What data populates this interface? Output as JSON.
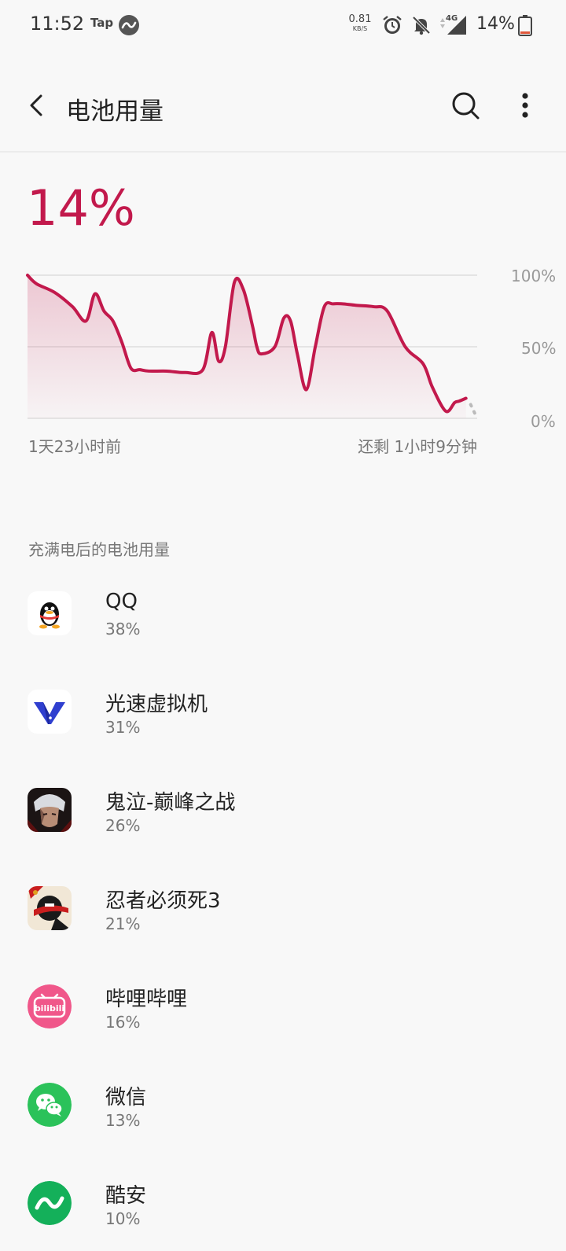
{
  "status_bar": {
    "time": "11:52",
    "tap_label": "Tap",
    "net_speed_value": "0.81",
    "net_speed_unit": "KB/S",
    "network_type": "4G",
    "battery_text": "14%"
  },
  "app_bar": {
    "title": "电池用量",
    "icons": {
      "back": "back-icon",
      "search": "search-icon",
      "more": "more-icon"
    }
  },
  "battery": {
    "level_text": "14%",
    "accent_color": "#c2194c"
  },
  "chart": {
    "y_ticks": [
      "100%",
      "50%",
      "0%"
    ],
    "start_label": "1天23小时前",
    "remaining_label": "还剩 1小时9分钟"
  },
  "chart_data": {
    "type": "area",
    "title": "",
    "xlabel": "",
    "ylabel": "",
    "ylim": [
      0,
      100
    ],
    "x": [
      0,
      2,
      6,
      10,
      13,
      15,
      17,
      19,
      21,
      23,
      25,
      27,
      31,
      35,
      39,
      41,
      42.5,
      44,
      46,
      48,
      50,
      51,
      52,
      55,
      57,
      58.5,
      60,
      62,
      64,
      66,
      68,
      70,
      73,
      77,
      80,
      84,
      88,
      90,
      93,
      95,
      96,
      97.5
    ],
    "values": [
      100,
      94,
      88,
      78,
      68,
      87,
      75,
      68,
      53,
      35,
      34,
      33,
      33,
      32,
      34,
      60,
      40,
      50,
      95,
      90,
      65,
      50,
      45,
      50,
      70,
      68,
      45,
      20,
      50,
      78,
      80,
      80,
      79,
      78,
      75,
      50,
      38,
      22,
      5,
      11,
      12,
      14
    ],
    "forecast_end": 0,
    "grid": true,
    "line_color": "#c2194c"
  },
  "section": {
    "header": "充满电后的电池用量"
  },
  "apps": [
    {
      "name": "QQ",
      "usage": "38%",
      "icon": "qq-icon"
    },
    {
      "name": "光速虚拟机",
      "usage": "31%",
      "icon": "vmos-icon"
    },
    {
      "name": "鬼泣-巅峰之战",
      "usage": "26%",
      "icon": "devil-may-cry-icon"
    },
    {
      "name": "忍者必须死3",
      "usage": "21%",
      "icon": "ninja-icon"
    },
    {
      "name": "哔哩哔哩",
      "usage": "16%",
      "icon": "bilibili-icon",
      "icon_text": "bilibili"
    },
    {
      "name": "微信",
      "usage": "13%",
      "icon": "wechat-icon"
    },
    {
      "name": "酷安",
      "usage": "10%",
      "icon": "coolapk-icon"
    }
  ]
}
